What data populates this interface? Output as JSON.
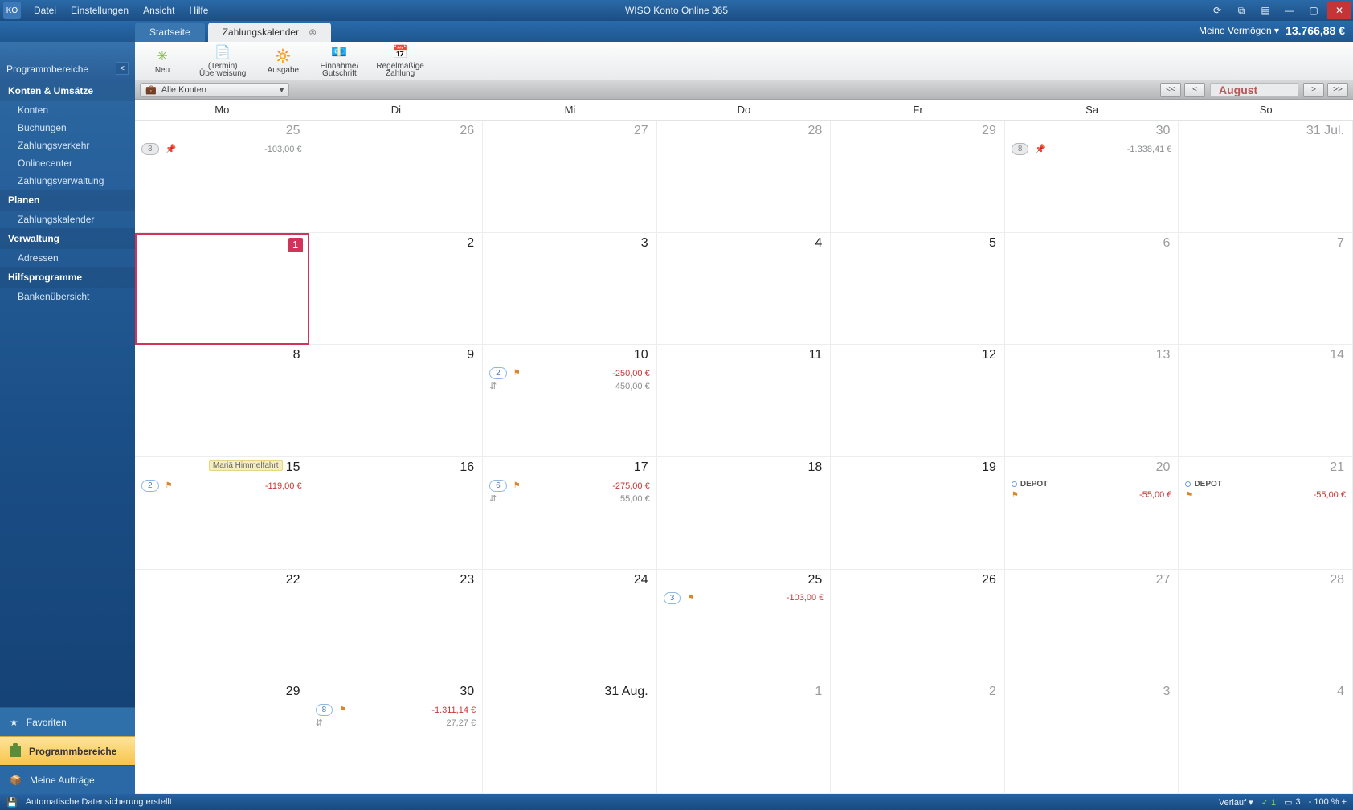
{
  "app": {
    "title": "WISO Konto Online 365"
  },
  "menus": [
    "Datei",
    "Einstellungen",
    "Ansicht",
    "Hilfe"
  ],
  "tabs": {
    "start": "Startseite",
    "active": "Zahlungskalender"
  },
  "summary": {
    "label": "Meine Vermögen ▾",
    "balance": "13.766,88 €"
  },
  "sidebar": {
    "header": "Programmbereiche",
    "s1_title": "Konten & Umsätze",
    "s1": [
      "Konten",
      "Buchungen",
      "Zahlungsverkehr",
      "Onlinecenter",
      "Zahlungsverwaltung"
    ],
    "s2_title": "Planen",
    "s2": [
      "Zahlungskalender"
    ],
    "s3_title": "Verwaltung",
    "s3": [
      "Adressen"
    ],
    "s4_title": "Hilfsprogramme",
    "s4": [
      "Bankenübersicht"
    ],
    "fav": "Favoriten",
    "prog": "Programmbereiche",
    "auf": "Meine Aufträge"
  },
  "ribbon": {
    "neu": "Neu",
    "termin1": "(Termin)",
    "termin2": "Überweisung",
    "ausgabe": "Ausgabe",
    "einnahme1": "Einnahme/",
    "einnahme2": "Gutschrift",
    "regel1": "Regelmäßige",
    "regel2": "Zahlung"
  },
  "filter": {
    "dropdown": "Alle Konten",
    "month": "August"
  },
  "weekdays": [
    "Mo",
    "Di",
    "Mi",
    "Do",
    "Fr",
    "Sa",
    "So"
  ],
  "cells": {
    "w0d0": {
      "num": "25",
      "other": true,
      "badge": "3",
      "badge_gray": true,
      "pin": true,
      "amt": "-103,00 €",
      "neg": false,
      "gray_amt": true
    },
    "w0d1": {
      "num": "26",
      "other": true
    },
    "w0d2": {
      "num": "27",
      "other": true
    },
    "w0d3": {
      "num": "28",
      "other": true
    },
    "w0d4": {
      "num": "29",
      "other": true
    },
    "w0d5": {
      "num": "30",
      "other": true,
      "badge": "8",
      "badge_gray": true,
      "pin": true,
      "amt": "-1.338,41 €",
      "gray_amt": true
    },
    "w0d6": {
      "num": "31 Jul.",
      "other": true
    },
    "w1d0": {
      "num": "1",
      "today": true
    },
    "w1d1": {
      "num": "2"
    },
    "w1d2": {
      "num": "3"
    },
    "w1d3": {
      "num": "4"
    },
    "w1d4": {
      "num": "5"
    },
    "w1d5": {
      "num": "6",
      "other": true
    },
    "w1d6": {
      "num": "7",
      "other": true
    },
    "w2d0": {
      "num": "8"
    },
    "w2d1": {
      "num": "9"
    },
    "w2d2": {
      "num": "10",
      "badge": "2",
      "flag": true,
      "amt": "-250,00 €",
      "neg": true,
      "amt2": "450,00 €"
    },
    "w2d3": {
      "num": "11"
    },
    "w2d4": {
      "num": "12"
    },
    "w2d5": {
      "num": "13",
      "other": true
    },
    "w2d6": {
      "num": "14",
      "other": true
    },
    "w3d0": {
      "num": "15",
      "holiday": "Mariä Himmelfahrt",
      "badge": "2",
      "flag": true,
      "amt": "-119,00 €",
      "neg": true
    },
    "w3d1": {
      "num": "16"
    },
    "w3d2": {
      "num": "17",
      "badge": "6",
      "flag": true,
      "amt": "-275,00 €",
      "neg": true,
      "amt2": "55,00 €"
    },
    "w3d3": {
      "num": "18"
    },
    "w3d4": {
      "num": "19"
    },
    "w3d5": {
      "num": "20",
      "other": true,
      "depot": "DEPOT",
      "flag": true,
      "amt": "-55,00 €",
      "neg": true
    },
    "w3d6": {
      "num": "21",
      "other": true,
      "depot": "DEPOT",
      "flag": true,
      "amt": "-55,00 €",
      "neg": true
    },
    "w4d0": {
      "num": "22"
    },
    "w4d1": {
      "num": "23"
    },
    "w4d2": {
      "num": "24"
    },
    "w4d3": {
      "num": "25",
      "badge": "3",
      "flag": true,
      "amt": "-103,00 €",
      "neg": true
    },
    "w4d4": {
      "num": "26"
    },
    "w4d5": {
      "num": "27",
      "other": true
    },
    "w4d6": {
      "num": "28",
      "other": true
    },
    "w5d0": {
      "num": "29"
    },
    "w5d1": {
      "num": "30",
      "badge": "8",
      "flag": true,
      "amt": "-1.311,14 €",
      "neg": true,
      "amt2": "27,27 €"
    },
    "w5d2": {
      "num": "31 Aug."
    },
    "w5d3": {
      "num": "1",
      "other": true
    },
    "w5d4": {
      "num": "2",
      "other": true
    },
    "w5d5": {
      "num": "3",
      "other": true
    },
    "w5d6": {
      "num": "4",
      "other": true
    }
  },
  "status": {
    "msg": "Automatische Datensicherung erstellt",
    "verlauf": "Verlauf  ▾",
    "ok": "✓ 1",
    "doc": "3",
    "zoom": "- 100 % +"
  }
}
